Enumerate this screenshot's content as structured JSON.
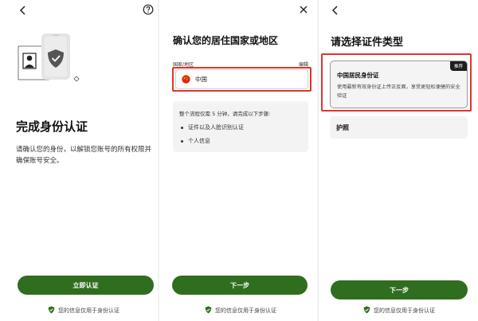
{
  "screen1": {
    "title": "完成身份认证",
    "description": "请确认您的身份，以解锁您账号的所有权限并确保账号安全。",
    "button_label": "立即认证",
    "privacy_note": "您的信息仅用于身份认证",
    "icons": [
      "back-arrow-icon",
      "help-icon",
      "id-card-shield-illustration",
      "shield-check-icon"
    ]
  },
  "screen2": {
    "title": "确认您的居住国家或地区",
    "field_label": "国家/地区",
    "edit_label": "编辑",
    "country_value": "中国",
    "info_intro": "整个流程仅需 5 分钟，请完成以下步骤:",
    "steps": [
      "证件以及人脸识别认证",
      "个人信息"
    ],
    "button_label": "下一步",
    "privacy_note": "您的信息仅用于身份认证",
    "icons": [
      "close-icon",
      "china-flag-icon",
      "shield-check-icon"
    ]
  },
  "screen3": {
    "title": "请选择证件类型",
    "card_title": "中国居民身份证",
    "card_badge": "推荐",
    "card_desc": "使用最新有效身份证上传正反面，享受更轻松便捷的安全验证",
    "option2_label": "护照",
    "button_label": "下一步",
    "privacy_note": "您的信息仅用于身份认证",
    "icons": [
      "back-arrow-icon",
      "shield-check-icon"
    ]
  },
  "colors": {
    "primary_green": "#2f6e1e",
    "highlight_red": "#e4332b",
    "badge_dark": "#1e1e1e",
    "info_bg": "#f3f3f3"
  }
}
